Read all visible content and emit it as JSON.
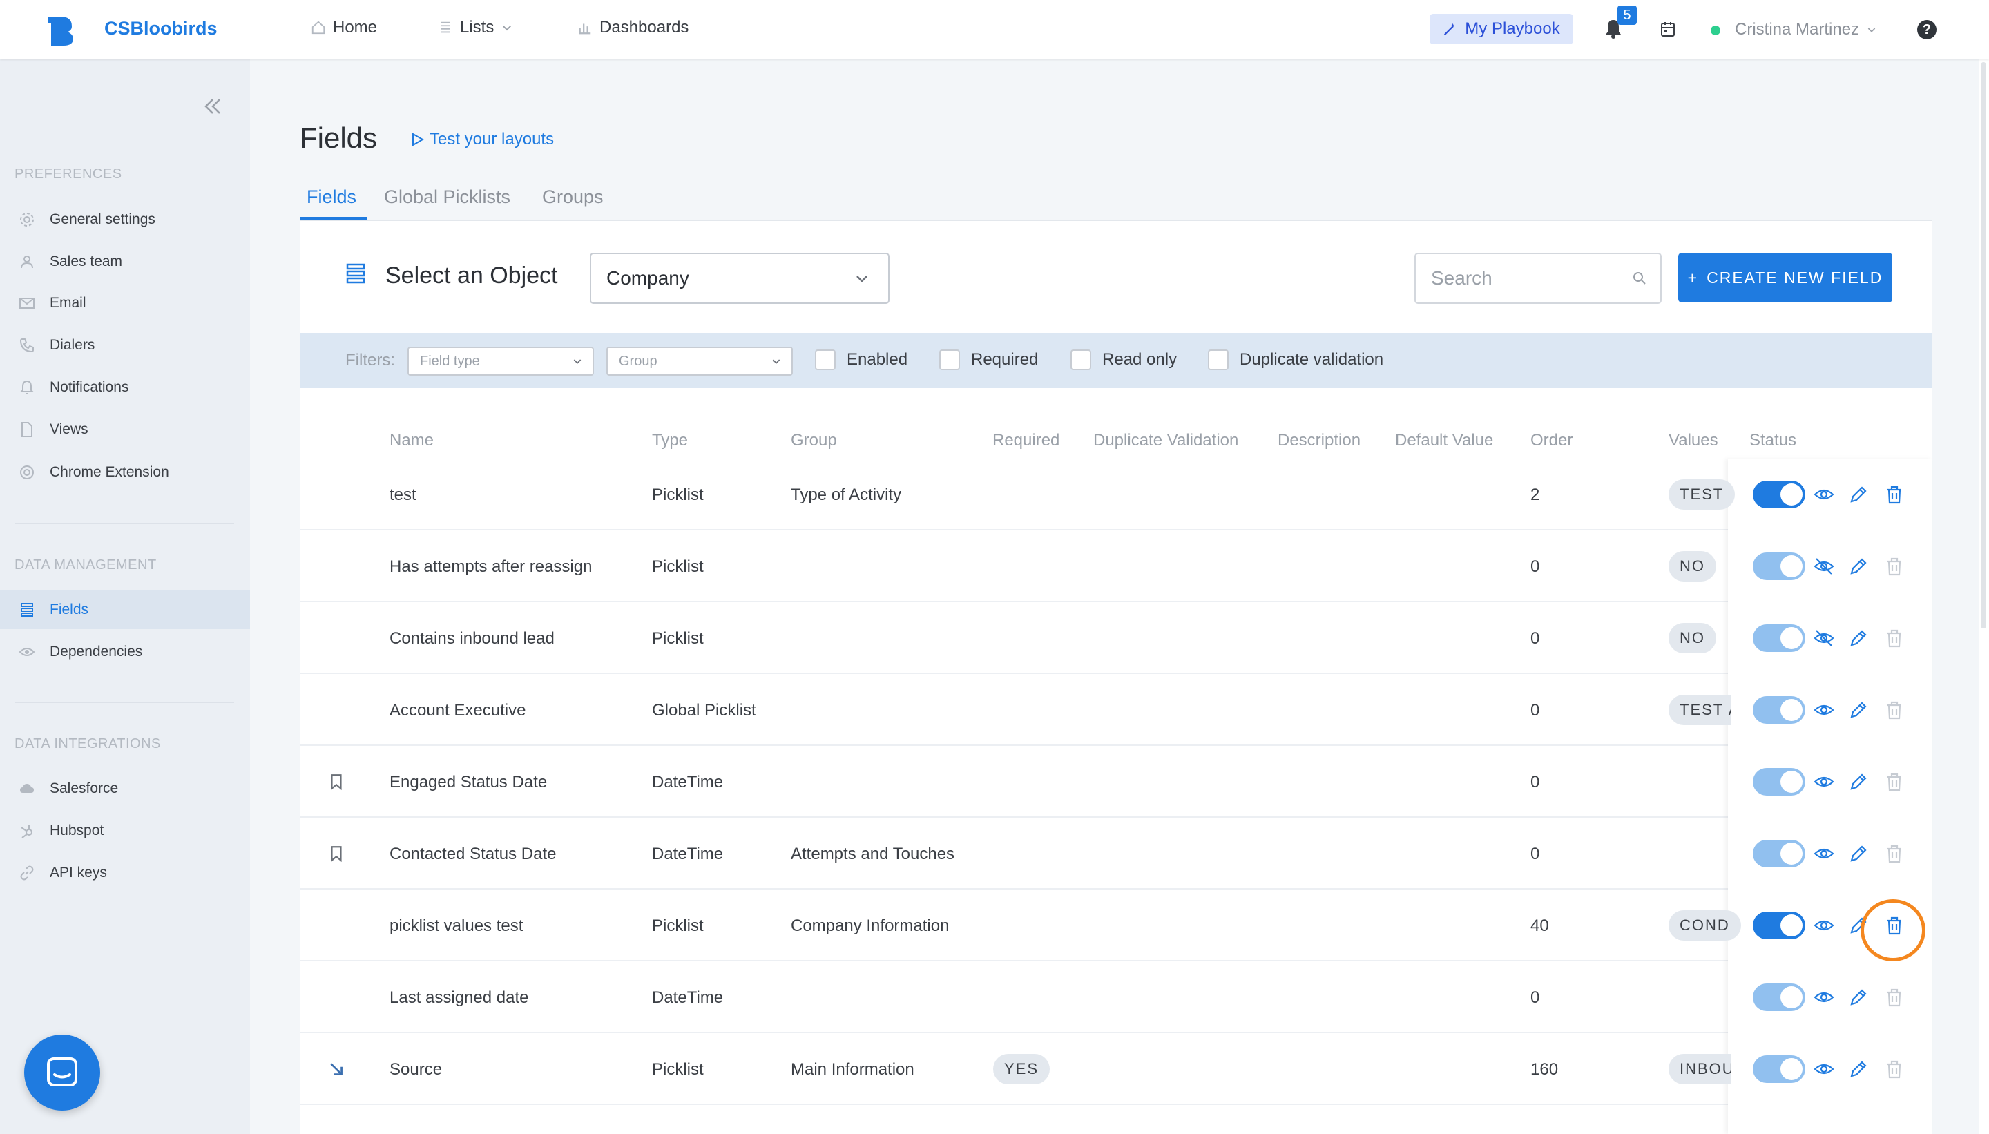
{
  "app": {
    "brand": "CSBloobirds"
  },
  "topnav": {
    "home": "Home",
    "lists": "Lists",
    "dashboards": "Dashboards",
    "playbook": "My Playbook",
    "notification_count": "5",
    "user_name": "Cristina Martinez",
    "help": "?"
  },
  "sidebar": {
    "preferences_title": "PREFERENCES",
    "preferences": [
      {
        "label": "General settings",
        "icon": "gear-icon"
      },
      {
        "label": "Sales team",
        "icon": "user-icon"
      },
      {
        "label": "Email",
        "icon": "mail-icon"
      },
      {
        "label": "Dialers",
        "icon": "phone-icon"
      },
      {
        "label": "Notifications",
        "icon": "bell-icon"
      },
      {
        "label": "Views",
        "icon": "file-icon"
      },
      {
        "label": "Chrome Extension",
        "icon": "chrome-icon"
      }
    ],
    "data_management_title": "DATA MANAGEMENT",
    "data_management": [
      {
        "label": "Fields",
        "icon": "list-icon",
        "active": true
      },
      {
        "label": "Dependencies",
        "icon": "eye-icon"
      }
    ],
    "data_integrations_title": "DATA INTEGRATIONS",
    "data_integrations": [
      {
        "label": "Salesforce",
        "icon": "cloud-icon"
      },
      {
        "label": "Hubspot",
        "icon": "hubspot-icon"
      },
      {
        "label": "API keys",
        "icon": "link-icon"
      }
    ]
  },
  "page": {
    "title": "Fields",
    "test_link": "Test your layouts",
    "tabs": [
      "Fields",
      "Global Picklists",
      "Groups"
    ],
    "active_tab": "Fields"
  },
  "object_bar": {
    "label": "Select an Object",
    "selected": "Company",
    "search_placeholder": "Search",
    "create_button": "CREATE NEW FIELD",
    "create_button_plus": "+"
  },
  "filters": {
    "label": "Filters:",
    "field_type_placeholder": "Field type",
    "group_placeholder": "Group",
    "checks": [
      "Enabled",
      "Required",
      "Read only",
      "Duplicate validation"
    ]
  },
  "table": {
    "headers": [
      "Name",
      "Type",
      "Group",
      "Required",
      "Duplicate Validation",
      "Description",
      "Default Value",
      "Order",
      "Values",
      "Status"
    ],
    "rows": [
      {
        "lead": "",
        "name": "test",
        "type": "Picklist",
        "group": "Type of Activity",
        "required": "",
        "order": "2",
        "value": "TEST",
        "enabled": true,
        "visible": true,
        "deletable": true
      },
      {
        "lead": "",
        "name": "Has attempts after reassign",
        "type": "Picklist",
        "group": "",
        "required": "",
        "order": "0",
        "value": "NO",
        "enabled": true,
        "visible": false,
        "deletable": false
      },
      {
        "lead": "",
        "name": "Contains inbound lead",
        "type": "Picklist",
        "group": "",
        "required": "",
        "order": "0",
        "value": "NO",
        "enabled": true,
        "visible": false,
        "deletable": false
      },
      {
        "lead": "",
        "name": "Account Executive",
        "type": "Global Picklist",
        "group": "",
        "required": "",
        "order": "0",
        "value": "TEST A",
        "enabled": true,
        "visible": true,
        "deletable": false
      },
      {
        "lead": "bookmark-icon",
        "name": "Engaged Status Date",
        "type": "DateTime",
        "group": "",
        "required": "",
        "order": "0",
        "value": "",
        "enabled": true,
        "visible": true,
        "deletable": false
      },
      {
        "lead": "bookmark-icon",
        "name": "Contacted Status Date",
        "type": "DateTime",
        "group": "Attempts and Touches",
        "required": "",
        "order": "0",
        "value": "",
        "enabled": true,
        "visible": true,
        "deletable": false
      },
      {
        "lead": "",
        "name": "picklist values test",
        "type": "Picklist",
        "group": "Company Information",
        "required": "",
        "order": "40",
        "value": "COND",
        "enabled": true,
        "visible": true,
        "deletable": true
      },
      {
        "lead": "",
        "name": "Last assigned date",
        "type": "DateTime",
        "group": "",
        "required": "",
        "order": "0",
        "value": "",
        "enabled": true,
        "visible": true,
        "deletable": false
      },
      {
        "lead": "arrow-down-right-icon",
        "name": "Source",
        "type": "Picklist",
        "group": "Main Information",
        "required": "YES",
        "order": "160",
        "value": "INBOU",
        "enabled": true,
        "visible": true,
        "deletable": false
      }
    ]
  },
  "colors": {
    "accent": "#1f7be0",
    "toggle_dim": "#91c0ef",
    "highlight": "#f4871f",
    "online": "#2dcf8f"
  }
}
